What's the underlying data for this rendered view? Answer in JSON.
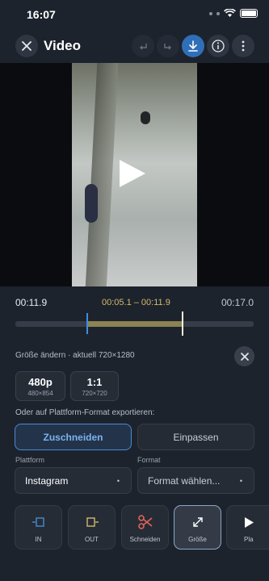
{
  "status_bar": {
    "time": "16:07"
  },
  "header": {
    "title": "Video"
  },
  "video": {
    "play_icon": "play-icon"
  },
  "timeline": {
    "start_time": "00:11.9",
    "range": "00:05.1 – 00:11.9",
    "end_time": "00:17.0",
    "selection_start_fraction": 0.3,
    "selection_end_fraction": 0.7
  },
  "resize": {
    "label": "Größe ändern · aktuell 720×1280",
    "options": [
      {
        "main": "480p",
        "sub": "480×854"
      },
      {
        "main": "1:1",
        "sub": "720×720"
      }
    ]
  },
  "export": {
    "label": "Oder auf Plattform-Format exportieren:",
    "modes": [
      "Zuschneiden",
      "Einpassen"
    ],
    "platform_label": "Plattform",
    "platform_value": "Instagram",
    "format_label": "Format",
    "format_value": "Format wählen..."
  },
  "tools": [
    {
      "label": "IN",
      "icon": "in-marker-icon"
    },
    {
      "label": "OUT",
      "icon": "out-marker-icon"
    },
    {
      "label": "Schneiden",
      "icon": "scissors-icon"
    },
    {
      "label": "Größe",
      "icon": "resize-arrows-icon"
    },
    {
      "label": "Pla",
      "icon": "play-icon"
    }
  ],
  "colors": {
    "accent": "#3f8de0",
    "selection": "#8c8253",
    "range_text": "#d2b96b"
  }
}
